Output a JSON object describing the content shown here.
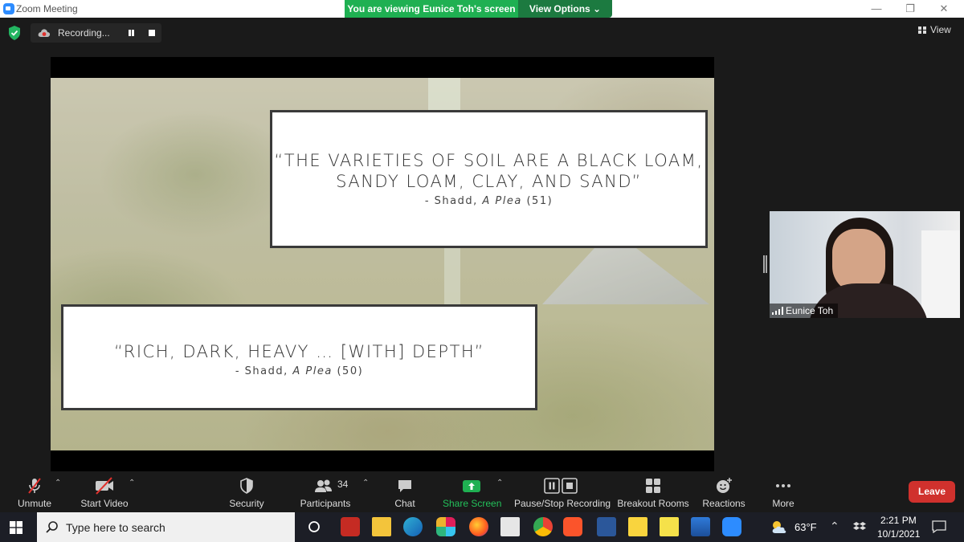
{
  "window": {
    "title": "Zoom Meeting"
  },
  "banner": {
    "viewing": "You are viewing Eunice Toh's screen",
    "view_options": "View Options ⌄"
  },
  "recording": {
    "label": "Recording..."
  },
  "view_button": {
    "label": "View"
  },
  "slide": {
    "quote1_line1": "“THE VARIETIES OF SOIL ARE A BLACK LOAM,",
    "quote1_line2": "SANDY LOAM, CLAY, AND SAND”",
    "cite1_prefix": "- Shadd, ",
    "cite1_title": "A Plea",
    "cite1_page": " (51)",
    "quote2": "“RICH, DARK, HEAVY … [WITH] DEPTH”",
    "cite2_prefix": "- Shadd, ",
    "cite2_title": "A Plea",
    "cite2_page": " (50)"
  },
  "participant_video": {
    "name": "Eunice Toh"
  },
  "toolbar": {
    "unmute": "Unmute",
    "start_video": "Start Video",
    "security": "Security",
    "participants": "Participants",
    "participants_count": "34",
    "chat": "Chat",
    "share_screen": "Share Screen",
    "pause_stop_recording": "Pause/Stop Recording",
    "breakout_rooms": "Breakout Rooms",
    "reactions": "Reactions",
    "more": "More",
    "leave": "Leave"
  },
  "taskbar": {
    "search_placeholder": "Type here to search",
    "temperature": "63°F",
    "time": "2:21 PM",
    "date": "10/1/2021"
  },
  "colors": {
    "share_green": "#1fb052",
    "leave_red": "#d0312d",
    "toolbar_bg": "#1a1a1a",
    "taskbar_bg": "#1c1e26"
  }
}
